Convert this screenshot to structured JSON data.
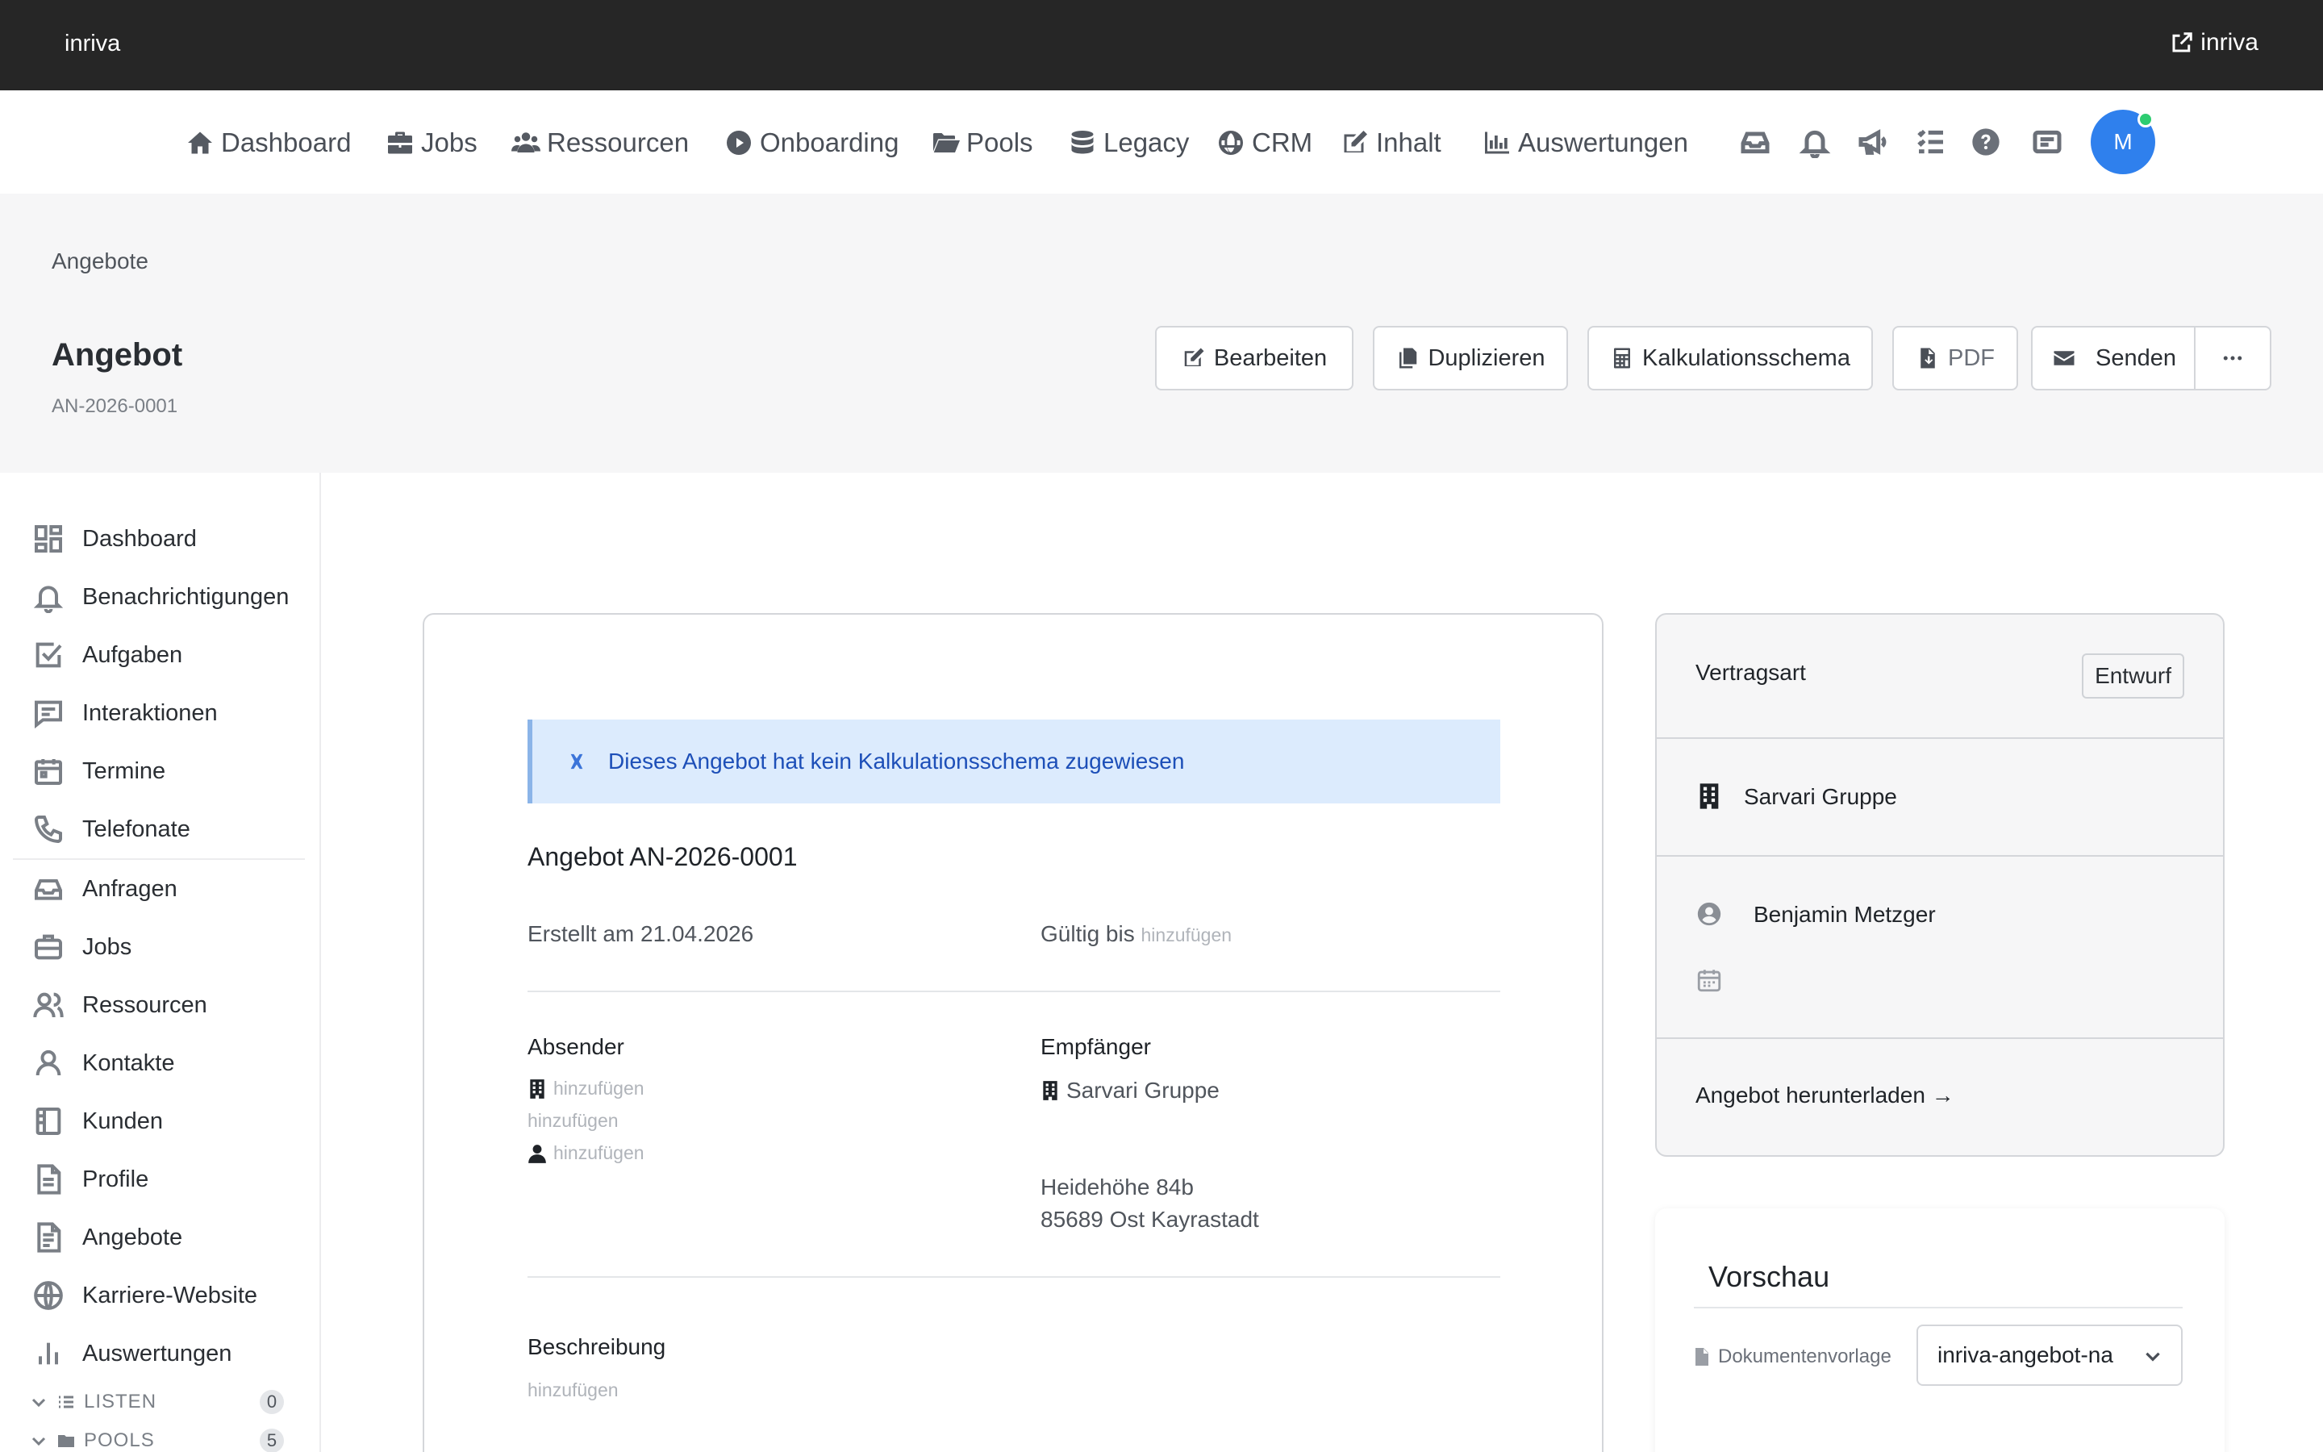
{
  "topbar": {
    "brand": "inriva",
    "external_link": "inriva"
  },
  "nav": {
    "items": [
      {
        "label": "Dashboard",
        "icon": "home-icon"
      },
      {
        "label": "Jobs",
        "icon": "briefcase-icon"
      },
      {
        "label": "Ressourcen",
        "icon": "users-icon"
      },
      {
        "label": "Onboarding",
        "icon": "play-circle-icon"
      },
      {
        "label": "Pools",
        "icon": "folder-open-icon"
      },
      {
        "label": "Legacy",
        "icon": "database-icon"
      },
      {
        "label": "CRM",
        "icon": "globe-icon"
      },
      {
        "label": "Inhalt",
        "icon": "edit-icon"
      },
      {
        "label": "Auswertungen",
        "icon": "chart-bar-icon"
      }
    ],
    "utility_icons": [
      "inbox-icon",
      "bell-icon",
      "megaphone-icon",
      "tasks-icon",
      "help-icon",
      "card-icon"
    ],
    "avatar_initial": "M",
    "avatar_color": "#2f80ed",
    "online_color": "#2ecc71"
  },
  "header": {
    "breadcrumb": "Angebote",
    "title": "Angebot",
    "subtitle": "AN-2026-0001",
    "buttons": {
      "edit": "Bearbeiten",
      "duplicate": "Duplizieren",
      "calc": "Kalkulationsschema",
      "pdf": "PDF",
      "send": "Senden"
    }
  },
  "sidebar": {
    "items": [
      {
        "label": "Dashboard",
        "icon": "grid-icon"
      },
      {
        "label": "Benachrichtigungen",
        "icon": "bell-icon"
      },
      {
        "label": "Aufgaben",
        "icon": "checkbox-icon"
      },
      {
        "label": "Interaktionen",
        "icon": "chat-icon"
      },
      {
        "label": "Termine",
        "icon": "calendar-icon"
      },
      {
        "label": "Telefonate",
        "icon": "phone-icon"
      },
      {
        "label": "Anfragen",
        "icon": "inbox-icon"
      },
      {
        "label": "Jobs",
        "icon": "briefcase-icon"
      },
      {
        "label": "Ressourcen",
        "icon": "users-icon"
      },
      {
        "label": "Kontakte",
        "icon": "user-icon"
      },
      {
        "label": "Kunden",
        "icon": "book-icon"
      },
      {
        "label": "Profile",
        "icon": "file-icon"
      },
      {
        "label": "Angebote",
        "icon": "document-icon"
      },
      {
        "label": "Karriere-Website",
        "icon": "globe-icon"
      },
      {
        "label": "Auswertungen",
        "icon": "bar-chart-icon"
      }
    ],
    "groups": [
      {
        "label": "LISTEN",
        "count": "0"
      },
      {
        "label": "POOLS",
        "count": "5"
      }
    ]
  },
  "document": {
    "alert": "Dieses Angebot hat kein Kalkulationsschema zugewiesen",
    "title": "Angebot AN-2026-0001",
    "created": "Erstellt am 21.04.2026",
    "valid_label": "Gültig bis",
    "add": "hinzufügen",
    "sender_label": "Absender",
    "recipient_label": "Empfänger",
    "recipient_company": "Sarvari Gruppe",
    "recipient_street": "Heidehöhe 84b",
    "recipient_city": "85689 Ost Kayrastadt",
    "description_label": "Beschreibung"
  },
  "panel": {
    "contract_label": "Vertragsart",
    "status": "Entwurf",
    "company": "Sarvari Gruppe",
    "contact": "Benjamin Metzger",
    "download": "Angebot herunterladen →"
  },
  "preview": {
    "title": "Vorschau",
    "template_label": "Dokumentenvorlage",
    "template_value": "inriva-angebot-na"
  }
}
